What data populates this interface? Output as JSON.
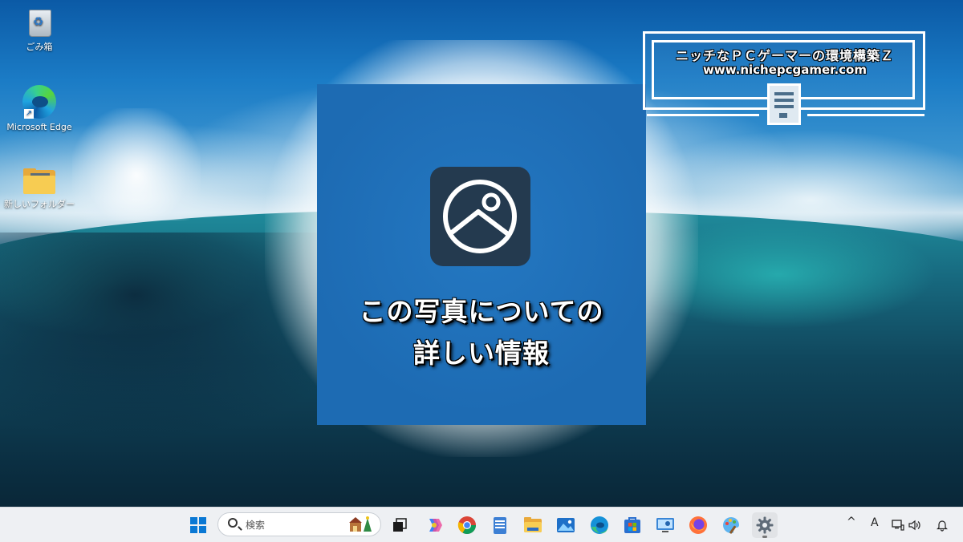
{
  "desktop": {
    "icons": [
      {
        "label": "ごみ箱",
        "icon": "recycle-bin-icon"
      },
      {
        "label": "Microsoft Edge",
        "icon": "edge-icon"
      },
      {
        "label": "新しいフォルダー",
        "icon": "folder-icon"
      }
    ]
  },
  "card": {
    "icon": "photo-icon",
    "title_line1": "この写真についての",
    "title_line2": "詳しい情報",
    "background": "#1f6fb8"
  },
  "watermark": {
    "title": "ニッチなＰＣゲーマーの環境構築Ｚ",
    "url": "www.nichepcgamer.com"
  },
  "taskbar": {
    "search_placeholder": "検索",
    "apps": [
      "start-icon",
      "task-view-icon",
      "copilot-icon",
      "chrome-icon",
      "notepad-icon",
      "file-explorer-icon",
      "photos-icon",
      "edge-icon",
      "store-icon",
      "remote-desktop-icon",
      "firefox-icon",
      "paint-icon",
      "settings-icon"
    ],
    "tray": {
      "chevron": "^",
      "ime": "A"
    }
  },
  "colors": {
    "accent": "#0a78d4",
    "taskbar_bg": "#eef0f3"
  }
}
